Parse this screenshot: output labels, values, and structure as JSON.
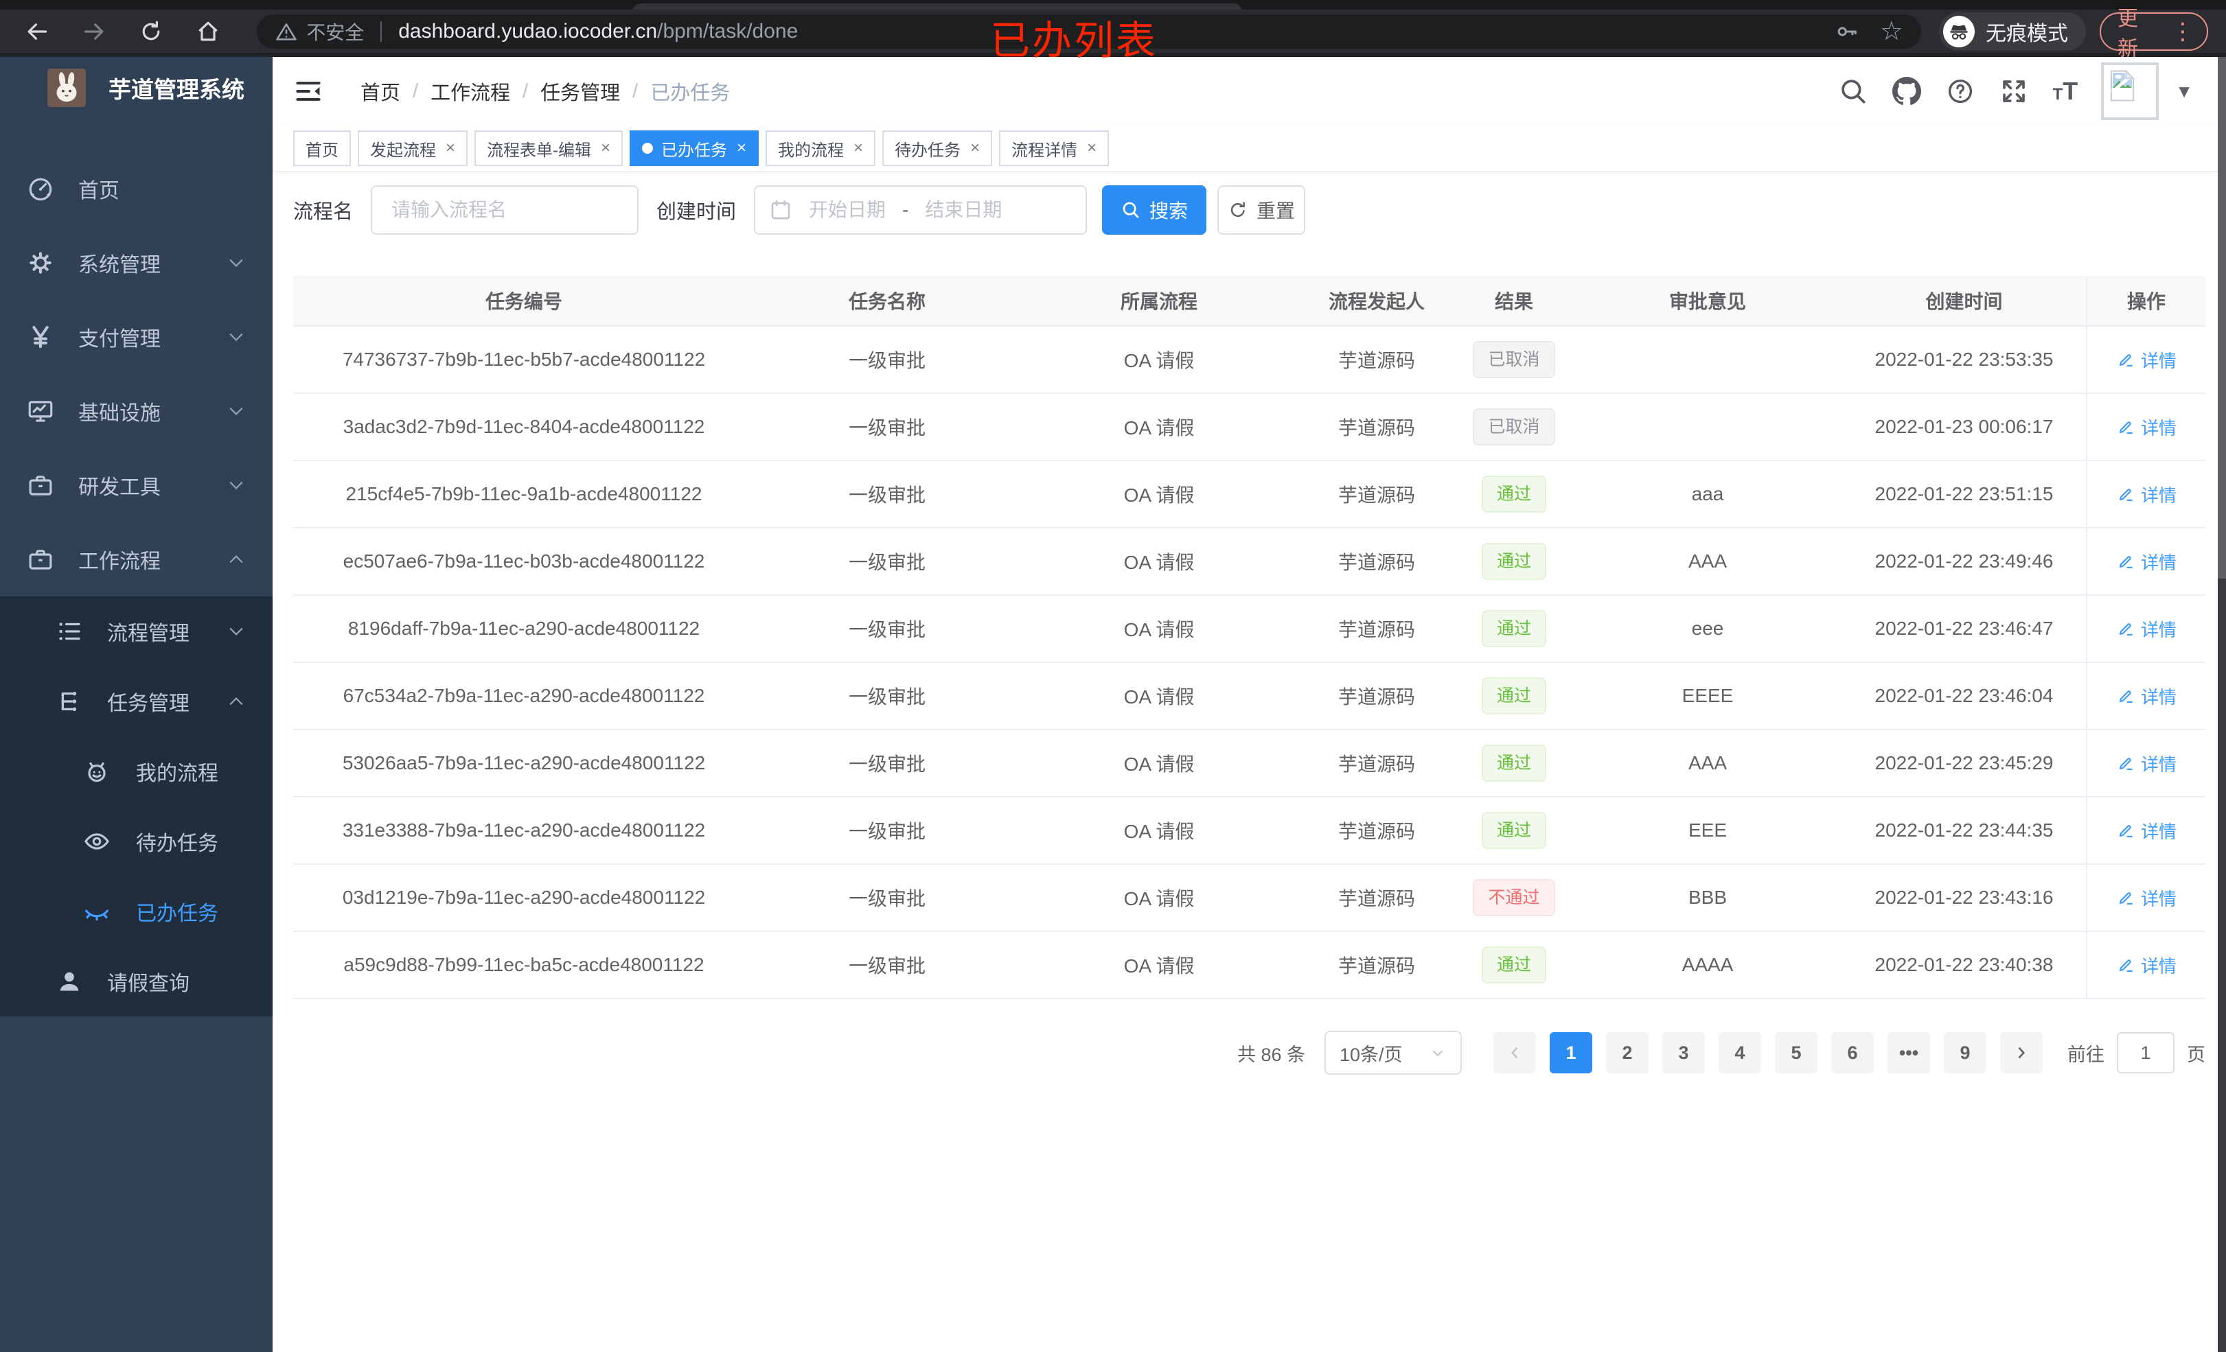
{
  "annotation": {
    "text": "已办列表",
    "color": "#ff2400"
  },
  "browser": {
    "security": "不安全",
    "url_host": "dashboard.yudao.iocoder.cn",
    "url_path": "/bpm/task/done",
    "incognito": "无痕模式",
    "update": "更新"
  },
  "sidebar": {
    "title": "芋道管理系统",
    "menu": [
      {
        "name": "sidebar-item-home",
        "label": "首页",
        "icon": "dashboard",
        "level": 1,
        "sub": false,
        "chevron": "",
        "active": false
      },
      {
        "name": "sidebar-item-system",
        "label": "系统管理",
        "icon": "gear",
        "level": 1,
        "sub": false,
        "chevron": "down",
        "active": false
      },
      {
        "name": "sidebar-item-payment",
        "label": "支付管理",
        "icon": "yen",
        "level": 1,
        "sub": false,
        "chevron": "down",
        "active": false
      },
      {
        "name": "sidebar-item-infra",
        "label": "基础设施",
        "icon": "monitor",
        "level": 1,
        "sub": false,
        "chevron": "down",
        "active": false
      },
      {
        "name": "sidebar-item-devtools",
        "label": "研发工具",
        "icon": "briefcase",
        "level": 1,
        "sub": false,
        "chevron": "down",
        "active": false
      },
      {
        "name": "sidebar-item-workflow",
        "label": "工作流程",
        "icon": "briefcase",
        "level": 1,
        "sub": false,
        "chevron": "up",
        "active": false
      },
      {
        "name": "sidebar-item-process-mgmt",
        "label": "流程管理",
        "icon": "list",
        "level": 2,
        "sub": true,
        "chevron": "down",
        "active": false
      },
      {
        "name": "sidebar-item-task-mgmt",
        "label": "任务管理",
        "icon": "tree",
        "level": 2,
        "sub": true,
        "chevron": "up",
        "active": false
      },
      {
        "name": "sidebar-item-my-process",
        "label": "我的流程",
        "icon": "robot",
        "level": 3,
        "sub": true,
        "chevron": "",
        "active": false
      },
      {
        "name": "sidebar-item-todo-tasks",
        "label": "待办任务",
        "icon": "eye",
        "level": 3,
        "sub": true,
        "chevron": "",
        "active": false
      },
      {
        "name": "sidebar-item-done-tasks",
        "label": "已办任务",
        "icon": "eye-closed",
        "level": 3,
        "sub": true,
        "chevron": "",
        "active": true
      },
      {
        "name": "sidebar-item-leave-query",
        "label": "请假查询",
        "icon": "user",
        "level": 2,
        "sub": true,
        "chevron": "",
        "active": false
      }
    ]
  },
  "breadcrumb": [
    "首页",
    "工作流程",
    "任务管理",
    "已办任务"
  ],
  "tabs": [
    {
      "name": "tab-home",
      "label": "首页",
      "closable": false,
      "active": false
    },
    {
      "name": "tab-start-process",
      "label": "发起流程",
      "closable": true,
      "active": false
    },
    {
      "name": "tab-form-edit",
      "label": "流程表单-编辑",
      "closable": true,
      "active": false
    },
    {
      "name": "tab-done-tasks",
      "label": "已办任务",
      "closable": true,
      "active": true
    },
    {
      "name": "tab-my-process",
      "label": "我的流程",
      "closable": true,
      "active": false
    },
    {
      "name": "tab-todo-tasks",
      "label": "待办任务",
      "closable": true,
      "active": false
    },
    {
      "name": "tab-process-detail",
      "label": "流程详情",
      "closable": true,
      "active": false
    }
  ],
  "filter": {
    "name_label": "流程名",
    "name_placeholder": "请输入流程名",
    "time_label": "创建时间",
    "start_placeholder": "开始日期",
    "range_separator": "-",
    "end_placeholder": "结束日期",
    "search": "搜索",
    "reset": "重置"
  },
  "table": {
    "columns": [
      "任务编号",
      "任务名称",
      "所属流程",
      "流程发起人",
      "结果",
      "审批意见",
      "创建时间",
      "操作"
    ],
    "detail_label": "详情",
    "rows": [
      {
        "id": "74736737-7b9b-11ec-b5b7-acde48001122",
        "name": "一级审批",
        "process": "OA 请假",
        "starter": "芋道源码",
        "result": "已取消",
        "result_type": "info",
        "comment": "",
        "time": "2022-01-22 23:53:35"
      },
      {
        "id": "3adac3d2-7b9d-11ec-8404-acde48001122",
        "name": "一级审批",
        "process": "OA 请假",
        "starter": "芋道源码",
        "result": "已取消",
        "result_type": "info",
        "comment": "",
        "time": "2022-01-23 00:06:17"
      },
      {
        "id": "215cf4e5-7b9b-11ec-9a1b-acde48001122",
        "name": "一级审批",
        "process": "OA 请假",
        "starter": "芋道源码",
        "result": "通过",
        "result_type": "success",
        "comment": "aaa",
        "time": "2022-01-22 23:51:15"
      },
      {
        "id": "ec507ae6-7b9a-11ec-b03b-acde48001122",
        "name": "一级审批",
        "process": "OA 请假",
        "starter": "芋道源码",
        "result": "通过",
        "result_type": "success",
        "comment": "AAA",
        "time": "2022-01-22 23:49:46"
      },
      {
        "id": "8196daff-7b9a-11ec-a290-acde48001122",
        "name": "一级审批",
        "process": "OA 请假",
        "starter": "芋道源码",
        "result": "通过",
        "result_type": "success",
        "comment": "eee",
        "time": "2022-01-22 23:46:47"
      },
      {
        "id": "67c534a2-7b9a-11ec-a290-acde48001122",
        "name": "一级审批",
        "process": "OA 请假",
        "starter": "芋道源码",
        "result": "通过",
        "result_type": "success",
        "comment": "EEEE",
        "time": "2022-01-22 23:46:04"
      },
      {
        "id": "53026aa5-7b9a-11ec-a290-acde48001122",
        "name": "一级审批",
        "process": "OA 请假",
        "starter": "芋道源码",
        "result": "通过",
        "result_type": "success",
        "comment": "AAA",
        "time": "2022-01-22 23:45:29"
      },
      {
        "id": "331e3388-7b9a-11ec-a290-acde48001122",
        "name": "一级审批",
        "process": "OA 请假",
        "starter": "芋道源码",
        "result": "通过",
        "result_type": "success",
        "comment": "EEE",
        "time": "2022-01-22 23:44:35"
      },
      {
        "id": "03d1219e-7b9a-11ec-a290-acde48001122",
        "name": "一级审批",
        "process": "OA 请假",
        "starter": "芋道源码",
        "result": "不通过",
        "result_type": "danger",
        "comment": "BBB",
        "time": "2022-01-22 23:43:16"
      },
      {
        "id": "a59c9d88-7b99-11ec-ba5c-acde48001122",
        "name": "一级审批",
        "process": "OA 请假",
        "starter": "芋道源码",
        "result": "通过",
        "result_type": "success",
        "comment": "AAAA",
        "time": "2022-01-22 23:40:38"
      }
    ]
  },
  "pagination": {
    "total_text": "共 86 条",
    "page_size": "10条/页",
    "pages": [
      "1",
      "2",
      "3",
      "4",
      "5",
      "6",
      "•••",
      "9"
    ],
    "active_page": "1",
    "goto_label": "前往",
    "goto_value": "1",
    "page_suffix": "页"
  },
  "colors": {
    "accent": "#2b8cf4",
    "success": "#67c23a",
    "danger": "#f56c6c",
    "info": "#909399",
    "sidebar_bg": "#304156",
    "submenu_bg": "#1f2d3d"
  }
}
